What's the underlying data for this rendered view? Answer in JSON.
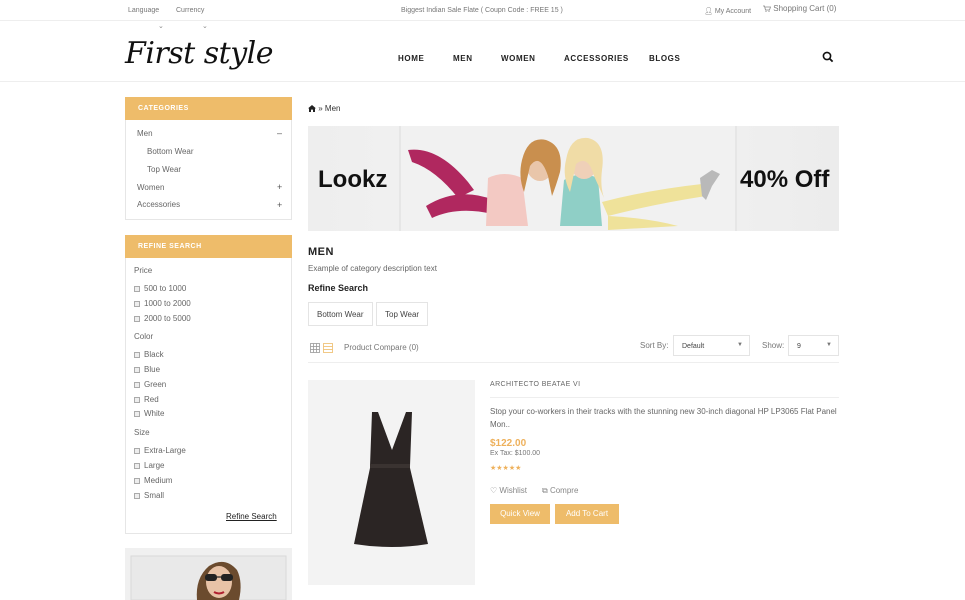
{
  "topbar": {
    "language": "Language",
    "currency": "Currency",
    "promo": "Biggest Indian Sale Flate ( Coupn Code : FREE 15 )",
    "account": "My Account",
    "cart": "Shopping Cart (0)"
  },
  "header": {
    "logo": "First style",
    "nav": [
      "HOME",
      "MEN",
      "WOMEN",
      "ACCESSORIES",
      "BLOGS"
    ]
  },
  "categories": {
    "title": "CATEGORIES",
    "items": [
      {
        "label": "Men",
        "toggle": "–"
      },
      {
        "label": "Bottom Wear"
      },
      {
        "label": "Top Wear"
      },
      {
        "label": "Women",
        "toggle": "+"
      },
      {
        "label": "Accessories",
        "toggle": "+"
      }
    ]
  },
  "refine": {
    "title": "REFINE SEARCH",
    "price_label": "Price",
    "prices": [
      "500 to 1000",
      "1000 to 2000",
      "2000 to 5000"
    ],
    "color_label": "Color",
    "colors": [
      "Black",
      "Blue",
      "Green",
      "Red",
      "White"
    ],
    "size_label": "Size",
    "sizes": [
      "Extra-Large",
      "Large",
      "Medium",
      "Small"
    ],
    "button": "Refine Search"
  },
  "breadcrumb": {
    "current": "Men"
  },
  "banner": {
    "left": "Lookz",
    "right": "40% Off"
  },
  "category": {
    "title": "MEN",
    "description": "Example of category description text",
    "refine_heading": "Refine Search",
    "subcats": [
      "Bottom Wear",
      "Top Wear"
    ]
  },
  "toolbar": {
    "compare": "Product Compare (0)",
    "sort_label": "Sort By:",
    "sort_value": "Default",
    "show_label": "Show:",
    "show_value": "9"
  },
  "product": {
    "name": "ARCHITECTO BEATAE VI",
    "description": "Stop your co-workers in their tracks with the stunning new 30-inch diagonal HP LP3065 Flat Panel Mon..",
    "price": "$122.00",
    "ex_tax": "Ex Tax: $100.00",
    "rating": 5,
    "stars": "★★★★★",
    "wishlist": "Wishlist",
    "compare": "Compre",
    "quick_view": "Quick View",
    "add_to_cart": "Add To Cart"
  },
  "colors": {
    "accent": "#eebc6a",
    "price": "#eeb15c"
  }
}
